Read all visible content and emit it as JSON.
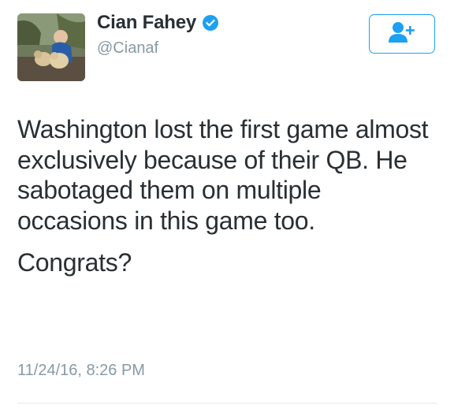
{
  "user": {
    "display_name": "Cian Fahey",
    "handle": "@Cianaf",
    "verified": true
  },
  "follow_button": {
    "icon": "add-user-icon"
  },
  "tweet": {
    "paragraphs": [
      "Washington lost the first game almost exclusively because of their QB. He sabotaged them on multiple occasions in this game too.",
      "Congrats?"
    ],
    "timestamp": "11/24/16, 8:26 PM"
  },
  "colors": {
    "accent": "#1da1f2",
    "text": "#292f33",
    "secondary": "#8899a6",
    "divider": "#e1e8ed"
  }
}
